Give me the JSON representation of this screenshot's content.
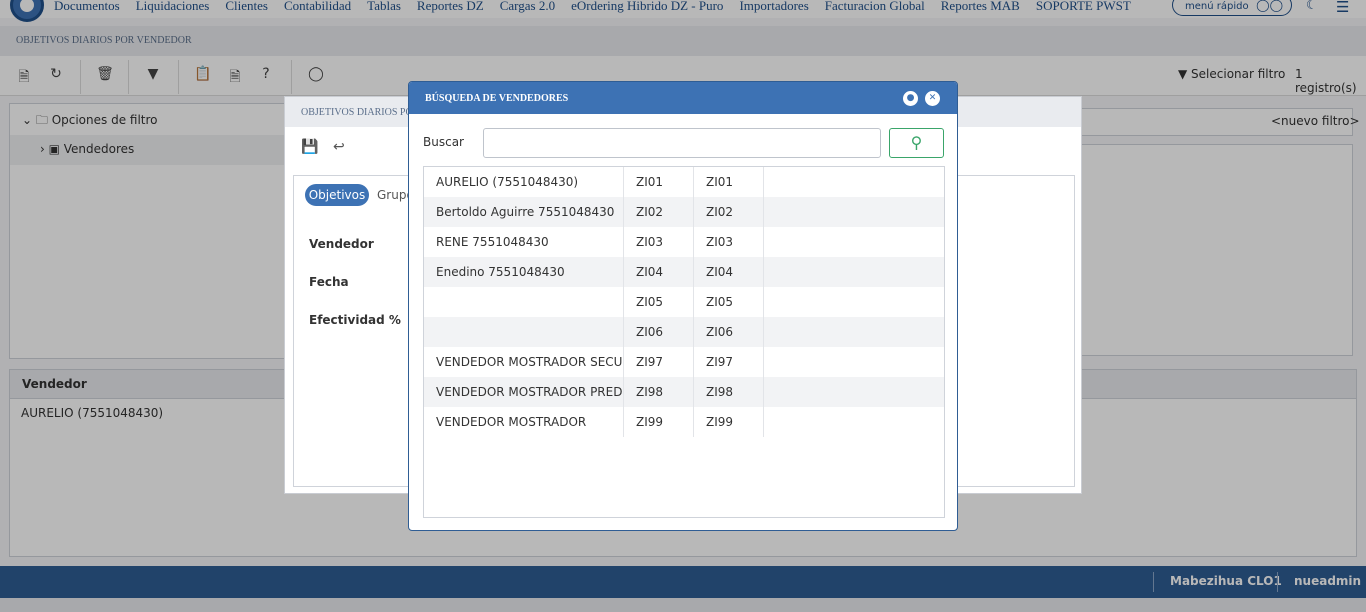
{
  "top_menu": {
    "items": [
      "Documentos",
      "Liquidaciones",
      "Clientes",
      "Contabilidad",
      "Tablas",
      "Reportes DZ",
      "Cargas 2.0",
      "eOrdering Hibrido DZ - Puro",
      "Importadores",
      "Facturacion Global",
      "Reportes MAB",
      "SOPORTE PWST"
    ],
    "quick_menu_label": "menú rápido"
  },
  "page": {
    "title": "OBJETIVOS DIARIOS POR VENDEDOR",
    "select_filter_label": "Selecionar filtro",
    "record_count": "1 registro(s)",
    "new_filter": "<nuevo filtro>"
  },
  "filter_tree": {
    "root_label": "Opciones de filtro",
    "child_label": "Vendedores"
  },
  "results": {
    "column_header": "Vendedor",
    "value": "AURELIO (7551048430)"
  },
  "edit_dialog": {
    "title": "OBJETIVOS DIARIOS POR VENDEDOR",
    "tabs": [
      "Objetivos",
      "Grupo"
    ],
    "labels": [
      "Vendedor",
      "Fecha",
      "Efectividad %"
    ]
  },
  "search_modal": {
    "title": "BÚSQUEDA DE VENDEDORES",
    "search_label": "Buscar",
    "search_value": "",
    "rows": [
      {
        "name": "AURELIO (7551048430)",
        "code": "ZI01",
        "code2": "ZI01"
      },
      {
        "name": "Bertoldo Aguirre 7551048430",
        "code": "ZI02",
        "code2": "ZI02"
      },
      {
        "name": "RENE 7551048430",
        "code": "ZI03",
        "code2": "ZI03"
      },
      {
        "name": "Enedino 7551048430",
        "code": "ZI04",
        "code2": "ZI04"
      },
      {
        "name": "",
        "code": "ZI05",
        "code2": "ZI05"
      },
      {
        "name": "",
        "code": "ZI06",
        "code2": "ZI06"
      },
      {
        "name": "VENDEDOR MOSTRADOR SECUNDARIO",
        "code": "ZI97",
        "code2": "ZI97"
      },
      {
        "name": "VENDEDOR MOSTRADOR PREDETERMINADO",
        "code": "ZI98",
        "code2": "ZI98"
      },
      {
        "name": "VENDEDOR MOSTRADOR",
        "code": "ZI99",
        "code2": "ZI99"
      }
    ]
  },
  "status_bar": {
    "branch": "Mabezihua CLO1",
    "user": "nueadmin"
  },
  "colors": {
    "brand_blue": "#3d72b4",
    "status_blue": "#2f5d94",
    "search_green": "#3aa56a"
  }
}
